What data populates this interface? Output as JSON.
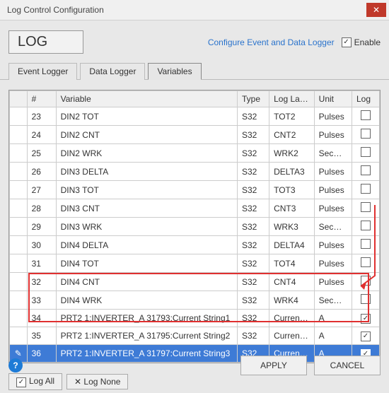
{
  "window": {
    "title": "Log Control Configuration"
  },
  "header": {
    "log_label": "LOG",
    "config_link": "Configure Event and Data Logger",
    "enable_label": "Enable",
    "enable_checked": true
  },
  "tabs": {
    "items": [
      {
        "id": "event",
        "label": "Event Logger",
        "active": false
      },
      {
        "id": "data",
        "label": "Data Logger",
        "active": false
      },
      {
        "id": "vars",
        "label": "Variables",
        "active": true
      }
    ]
  },
  "table": {
    "columns": [
      "#",
      "Variable",
      "Type",
      "Log Label",
      "Unit",
      "Log"
    ],
    "rows": [
      {
        "n": "23",
        "var": "DIN2 TOT",
        "type": "S32",
        "lbl": "TOT2",
        "unit": "Pulses",
        "log": false,
        "sel": false,
        "ind": ""
      },
      {
        "n": "24",
        "var": "DIN2 CNT",
        "type": "S32",
        "lbl": "CNT2",
        "unit": "Pulses",
        "log": false,
        "sel": false,
        "ind": ""
      },
      {
        "n": "25",
        "var": "DIN2 WRK",
        "type": "S32",
        "lbl": "WRK2",
        "unit": "Sec…",
        "log": false,
        "sel": false,
        "ind": ""
      },
      {
        "n": "26",
        "var": "DIN3 DELTA",
        "type": "S32",
        "lbl": "DELTA3",
        "unit": "Pulses",
        "log": false,
        "sel": false,
        "ind": ""
      },
      {
        "n": "27",
        "var": "DIN3 TOT",
        "type": "S32",
        "lbl": "TOT3",
        "unit": "Pulses",
        "log": false,
        "sel": false,
        "ind": ""
      },
      {
        "n": "28",
        "var": "DIN3 CNT",
        "type": "S32",
        "lbl": "CNT3",
        "unit": "Pulses",
        "log": false,
        "sel": false,
        "ind": ""
      },
      {
        "n": "29",
        "var": "DIN3 WRK",
        "type": "S32",
        "lbl": "WRK3",
        "unit": "Sec…",
        "log": false,
        "sel": false,
        "ind": ""
      },
      {
        "n": "30",
        "var": "DIN4 DELTA",
        "type": "S32",
        "lbl": "DELTA4",
        "unit": "Pulses",
        "log": false,
        "sel": false,
        "ind": ""
      },
      {
        "n": "31",
        "var": "DIN4 TOT",
        "type": "S32",
        "lbl": "TOT4",
        "unit": "Pulses",
        "log": false,
        "sel": false,
        "ind": ""
      },
      {
        "n": "32",
        "var": "DIN4 CNT",
        "type": "S32",
        "lbl": "CNT4",
        "unit": "Pulses",
        "log": false,
        "sel": false,
        "ind": ""
      },
      {
        "n": "33",
        "var": "DIN4 WRK",
        "type": "S32",
        "lbl": "WRK4",
        "unit": "Sec…",
        "log": false,
        "sel": false,
        "ind": ""
      },
      {
        "n": "34",
        "var": "PRT2 1:INVERTER_A 31793:Current String1",
        "type": "S32",
        "lbl": "Current …",
        "unit": "A",
        "log": true,
        "sel": false,
        "ind": ""
      },
      {
        "n": "35",
        "var": "PRT2 1:INVERTER_A 31795:Current String2",
        "type": "S32",
        "lbl": "Current …",
        "unit": "A",
        "log": true,
        "sel": false,
        "ind": ""
      },
      {
        "n": "36",
        "var": "PRT2 1:INVERTER_A 31797:Current String3",
        "type": "S32",
        "lbl": "Current …",
        "unit": "A",
        "log": true,
        "sel": true,
        "ind": "✎"
      }
    ]
  },
  "buttons": {
    "log_all": "Log All",
    "log_none": "Log None",
    "apply": "APPLY",
    "cancel": "CANCEL"
  }
}
